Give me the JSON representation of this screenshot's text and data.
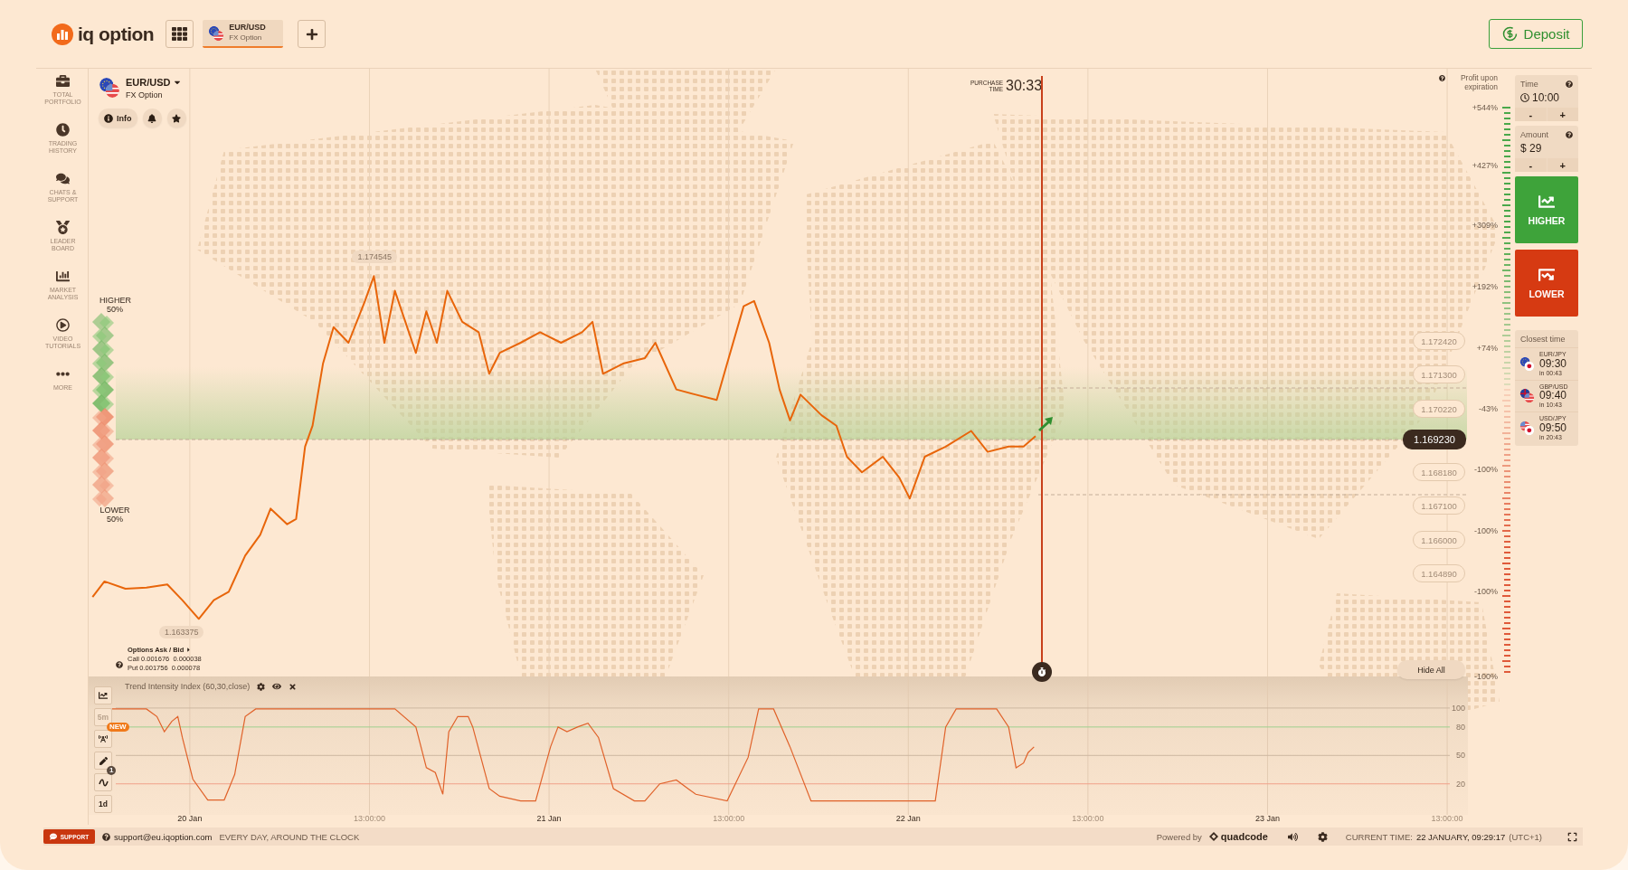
{
  "header": {
    "logo": "iq option",
    "tabs": [
      {
        "symbol": "EUR/USD",
        "type": "FX Option",
        "selected": true
      }
    ],
    "deposit": "Deposit"
  },
  "sidebar": {
    "items": [
      {
        "label": "TOTAL PORTFOLIO"
      },
      {
        "label": "TRADING HISTORY"
      },
      {
        "label": "CHATS & SUPPORT"
      },
      {
        "label": "LEADER BOARD"
      },
      {
        "label": "MARKET ANALYSIS"
      },
      {
        "label": "VIDEO TUTORIALS"
      },
      {
        "label": "MORE"
      }
    ]
  },
  "asset": {
    "symbol": "EUR/USD",
    "type": "FX Option",
    "info": "Info"
  },
  "sentiment": {
    "higher_label": "HIGHER",
    "higher": "50%",
    "lower_label": "LOWER",
    "lower": "50%"
  },
  "purchase": {
    "label": "PURCHASE TIME",
    "time": "30:33"
  },
  "chart": {
    "high": "1.174545",
    "low": "1.163375",
    "current_price": "1.169230",
    "price_levels": [
      "1.172420",
      "1.171300",
      "1.170220",
      "1.168180",
      "1.167100",
      "1.166000",
      "1.164890"
    ],
    "time_axis": [
      "20 Jan",
      "13:00:00",
      "21 Jan",
      "13:00:00",
      "22 Jan",
      "13:00:00",
      "23 Jan",
      "13:00:00"
    ]
  },
  "profit": {
    "title": "Profit upon expiration",
    "scale": [
      "+544%",
      "+427%",
      "+309%",
      "+192%",
      "+74%",
      "-43%",
      "-100%",
      "-100%",
      "-100%",
      "-100%"
    ]
  },
  "options_ask_bid": {
    "title": "Options Ask / Bid",
    "rows": [
      "Call 0.001676  0.000038",
      "Put 0.001756  0.000078"
    ]
  },
  "hide_all": "Hide All",
  "indicator": {
    "title": "Trend Intensity Index (60,30,close)",
    "levels": [
      "100",
      "80",
      "50",
      "20"
    ]
  },
  "tools": [
    {
      "kind": "chart",
      "disabled": false
    },
    {
      "kind": "period",
      "label": "5m",
      "disabled": true
    },
    {
      "kind": "signals",
      "badge": "NEW",
      "disabled": false
    },
    {
      "kind": "draw",
      "disabled": false
    },
    {
      "kind": "indicators",
      "badge": "1",
      "disabled": false
    },
    {
      "kind": "period",
      "label": "1d",
      "disabled": false
    }
  ],
  "trade": {
    "time_label": "Time",
    "time": "10:00",
    "amount_label": "Amount",
    "amount": "$ 29",
    "minus": "-",
    "plus": "+",
    "higher": "HIGHER",
    "lower": "LOWER"
  },
  "closest": {
    "title": "Closest time",
    "items": [
      {
        "pair": "EUR/JPY",
        "time": "09:30",
        "countdown": "in 00:43"
      },
      {
        "pair": "GBP/USD",
        "time": "09:40",
        "countdown": "in 10:43"
      },
      {
        "pair": "USD/JPY",
        "time": "09:50",
        "countdown": "in 20:43"
      }
    ]
  },
  "footer": {
    "support": "SUPPORT",
    "email": "support@eu.iqoption.com",
    "hours": "EVERY DAY, AROUND THE CLOCK",
    "powered_by": "Powered by",
    "brand": "quadcode",
    "current_time_label": "CURRENT TIME:",
    "current_time": "22 JANUARY, 09:29:17",
    "timezone": "(UTC+1)"
  }
}
